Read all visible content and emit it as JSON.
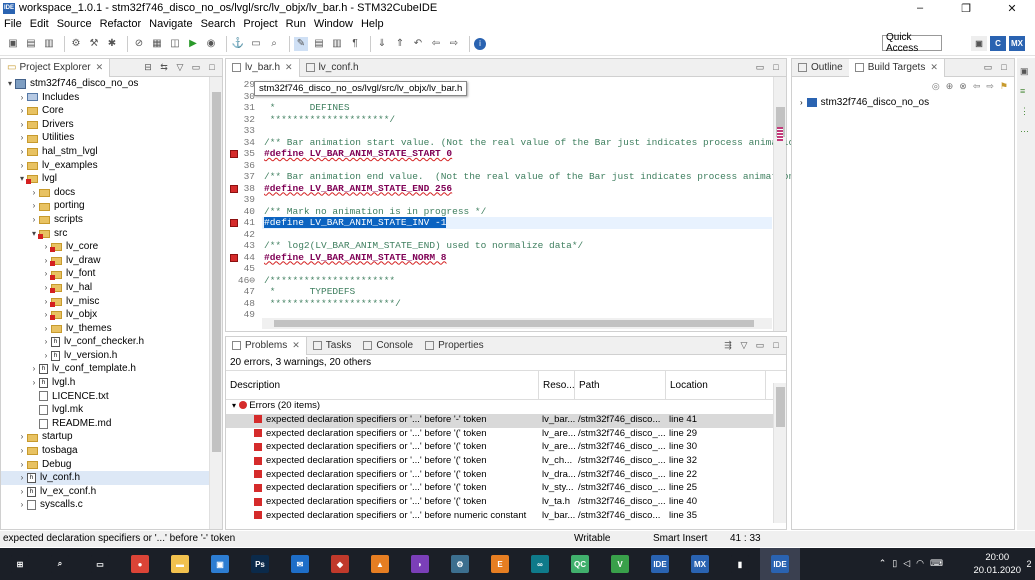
{
  "window": {
    "title": "workspace_1.0.1 - stm32f746_disco_no_os/lvgl/src/lv_objx/lv_bar.h - STM32CubeIDE",
    "app_icon": "IDE",
    "minimize": "–",
    "maximize": "❐",
    "close": "✕"
  },
  "menu": [
    "File",
    "Edit",
    "Source",
    "Refactor",
    "Navigate",
    "Search",
    "Project",
    "Run",
    "Window",
    "Help"
  ],
  "quick_access": "Quick Access",
  "project_explorer": {
    "tab_label": "Project Explorer",
    "items": [
      {
        "label": "stm32f746_disco_no_os",
        "depth": 0,
        "tw": "▾",
        "icon": "proj"
      },
      {
        "label": "Includes",
        "depth": 1,
        "tw": "›",
        "icon": "lib"
      },
      {
        "label": "Core",
        "depth": 1,
        "tw": "›",
        "icon": "folder"
      },
      {
        "label": "Drivers",
        "depth": 1,
        "tw": "›",
        "icon": "folder"
      },
      {
        "label": "Utilities",
        "depth": 1,
        "tw": "›",
        "icon": "folder"
      },
      {
        "label": "hal_stm_lvgl",
        "depth": 1,
        "tw": "›",
        "icon": "folder"
      },
      {
        "label": "lv_examples",
        "depth": 1,
        "tw": "›",
        "icon": "folder"
      },
      {
        "label": "lvgl",
        "depth": 1,
        "tw": "▾",
        "icon": "folder",
        "err": true
      },
      {
        "label": "docs",
        "depth": 2,
        "tw": "›",
        "icon": "folder"
      },
      {
        "label": "porting",
        "depth": 2,
        "tw": "›",
        "icon": "folder"
      },
      {
        "label": "scripts",
        "depth": 2,
        "tw": "›",
        "icon": "folder"
      },
      {
        "label": "src",
        "depth": 2,
        "tw": "▾",
        "icon": "folder",
        "err": true
      },
      {
        "label": "lv_core",
        "depth": 3,
        "tw": "›",
        "icon": "folder",
        "err": true
      },
      {
        "label": "lv_draw",
        "depth": 3,
        "tw": "›",
        "icon": "folder",
        "err": true
      },
      {
        "label": "lv_font",
        "depth": 3,
        "tw": "›",
        "icon": "folder",
        "err": true
      },
      {
        "label": "lv_hal",
        "depth": 3,
        "tw": "›",
        "icon": "folder",
        "err": true
      },
      {
        "label": "lv_misc",
        "depth": 3,
        "tw": "›",
        "icon": "folder",
        "err": true
      },
      {
        "label": "lv_objx",
        "depth": 3,
        "tw": "›",
        "icon": "folder",
        "err": true
      },
      {
        "label": "lv_themes",
        "depth": 3,
        "tw": "›",
        "icon": "folder"
      },
      {
        "label": "lv_conf_checker.h",
        "depth": 3,
        "tw": "›",
        "icon": "hfile"
      },
      {
        "label": "lv_version.h",
        "depth": 3,
        "tw": "›",
        "icon": "hfile"
      },
      {
        "label": "lv_conf_template.h",
        "depth": 2,
        "tw": "›",
        "icon": "hfile"
      },
      {
        "label": "lvgl.h",
        "depth": 2,
        "tw": "›",
        "icon": "hfile"
      },
      {
        "label": "LICENCE.txt",
        "depth": 2,
        "tw": "",
        "icon": "file"
      },
      {
        "label": "lvgl.mk",
        "depth": 2,
        "tw": "",
        "icon": "file"
      },
      {
        "label": "README.md",
        "depth": 2,
        "tw": "",
        "icon": "file"
      },
      {
        "label": "startup",
        "depth": 1,
        "tw": "›",
        "icon": "folder"
      },
      {
        "label": "tosbaga",
        "depth": 1,
        "tw": "›",
        "icon": "folder"
      },
      {
        "label": "Debug",
        "depth": 1,
        "tw": "›",
        "icon": "folder"
      },
      {
        "label": "lv_conf.h",
        "depth": 1,
        "tw": "›",
        "icon": "hfile",
        "selected": true
      },
      {
        "label": "lv_ex_conf.h",
        "depth": 1,
        "tw": "›",
        "icon": "hfile"
      },
      {
        "label": "syscalls.c",
        "depth": 1,
        "tw": "›",
        "icon": "file"
      }
    ]
  },
  "editor": {
    "tabs": [
      {
        "label": "lv_bar.h",
        "active": true
      },
      {
        "label": "lv_conf.h",
        "active": false
      }
    ],
    "tooltip": "stm32f746_disco_no_os/lvgl/src/lv_objx/lv_bar.h",
    "lines": [
      {
        "n": "29",
        "text": "",
        "cls": "cm"
      },
      {
        "n": "30",
        "text": "",
        "cls": "cm"
      },
      {
        "n": "31",
        "text": " *      DEFINES",
        "cls": "cm"
      },
      {
        "n": "32",
        "text": " *********************/",
        "cls": "cm"
      },
      {
        "n": "33",
        "text": "",
        "cls": "def"
      },
      {
        "n": "34",
        "text": "/** Bar animation start value. (Not the real value of the Bar just indicates process animation)",
        "cls": "cm"
      },
      {
        "n": "35",
        "text": "#define LV_BAR_ANIM_STATE_START 0",
        "cls": "kw",
        "err": true
      },
      {
        "n": "36",
        "text": "",
        "cls": "def"
      },
      {
        "n": "37",
        "text": "/** Bar animation end value.  (Not the real value of the Bar just indicates process animation)*",
        "cls": "cm"
      },
      {
        "n": "38",
        "text": "#define LV_BAR_ANIM_STATE_END 256",
        "cls": "kw",
        "err": true
      },
      {
        "n": "39",
        "text": "",
        "cls": "def"
      },
      {
        "n": "40",
        "text": "/** Mark no animation is in progress */",
        "cls": "cm"
      },
      {
        "n": "41",
        "text": "#define LV_BAR_ANIM_STATE_INV -1",
        "cls": "sel",
        "err": true,
        "current": true
      },
      {
        "n": "42",
        "text": "",
        "cls": "def"
      },
      {
        "n": "43",
        "text": "/** log2(LV_BAR_ANIM_STATE_END) used to normalize data*/",
        "cls": "cm"
      },
      {
        "n": "44",
        "text": "#define LV_BAR_ANIM_STATE_NORM 8",
        "cls": "kw",
        "err": true
      },
      {
        "n": "45",
        "text": "",
        "cls": "def"
      },
      {
        "n": "46⊖",
        "text": "/**********************",
        "cls": "cm"
      },
      {
        "n": "47",
        "text": " *      TYPEDEFS",
        "cls": "cm"
      },
      {
        "n": "48",
        "text": " **********************/",
        "cls": "cm"
      },
      {
        "n": "49",
        "text": "",
        "cls": "def"
      }
    ]
  },
  "outline": {
    "tabs": [
      {
        "label": "Outline",
        "active": false
      },
      {
        "label": "Build Targets",
        "active": true
      }
    ],
    "items": [
      {
        "label": "stm32f746_disco_no_os"
      }
    ]
  },
  "problems": {
    "tabs": [
      {
        "label": "Problems",
        "active": true
      },
      {
        "label": "Tasks",
        "active": false
      },
      {
        "label": "Console",
        "active": false
      },
      {
        "label": "Properties",
        "active": false
      }
    ],
    "summary": "20 errors, 3 warnings, 20 others",
    "columns": [
      "Description",
      "Reso...",
      "Path",
      "Location"
    ],
    "group": "Errors (20 items)",
    "rows": [
      {
        "desc": "expected declaration specifiers or '...' before '-' token",
        "res": "lv_bar...",
        "path": "/stm32f746_disco...",
        "loc": "line 41",
        "selected": true
      },
      {
        "desc": "expected declaration specifiers or '...' before '(' token",
        "res": "lv_are...",
        "path": "/stm32f746_disco_...",
        "loc": "line 29"
      },
      {
        "desc": "expected declaration specifiers or '...' before '(' token",
        "res": "lv_are...",
        "path": "/stm32f746_disco_...",
        "loc": "line 30"
      },
      {
        "desc": "expected declaration specifiers or '...' before '(' token",
        "res": "lv_ch...",
        "path": "/stm32f746_disco_...",
        "loc": "line 32"
      },
      {
        "desc": "expected declaration specifiers or '...' before '(' token",
        "res": "lv_dra...",
        "path": "/stm32f746_disco_...",
        "loc": "line 22"
      },
      {
        "desc": "expected declaration specifiers or '...' before '(' token",
        "res": "lv_sty...",
        "path": "/stm32f746_disco_...",
        "loc": "line 25"
      },
      {
        "desc": "expected declaration specifiers or '...' before '(' token",
        "res": "lv_ta.h",
        "path": "/stm32f746_disco_...",
        "loc": "line 40"
      },
      {
        "desc": "expected declaration specifiers or '...' before numeric constant",
        "res": "lv_bar...",
        "path": "/stm32f746_disco...",
        "loc": "line 35"
      }
    ]
  },
  "status": {
    "message": "expected declaration specifiers or '...' before '-' token",
    "writable": "Writable",
    "insert": "Smart Insert",
    "position": "41 : 33"
  },
  "taskbar": {
    "apps": [
      {
        "name": "start",
        "label": "⊞",
        "color": "#1b1f27"
      },
      {
        "name": "search",
        "label": "⌕",
        "color": "#1b1f27"
      },
      {
        "name": "taskview",
        "label": "▭",
        "color": "#1b1f27"
      },
      {
        "name": "chrome",
        "label": "●",
        "color": "#db4437"
      },
      {
        "name": "explorer",
        "label": "▬",
        "color": "#f2c14e"
      },
      {
        "name": "store",
        "label": "▣",
        "color": "#2d7dd2"
      },
      {
        "name": "photoshop",
        "label": "Ps",
        "color": "#0b2a4a"
      },
      {
        "name": "mail",
        "label": "✉",
        "color": "#1e6ec8"
      },
      {
        "name": "app-red",
        "label": "◆",
        "color": "#c0392b"
      },
      {
        "name": "matlab",
        "label": "▲",
        "color": "#e67e22"
      },
      {
        "name": "visual-studio",
        "label": "◗",
        "color": "#7b3fb8"
      },
      {
        "name": "app-gear",
        "label": "⚙",
        "color": "#3c6f8f"
      },
      {
        "name": "app-e",
        "label": "E",
        "color": "#e67e22"
      },
      {
        "name": "arduino",
        "label": "∞",
        "color": "#0f7a8a"
      },
      {
        "name": "qt",
        "label": "QC",
        "color": "#41b06d"
      },
      {
        "name": "cubemx-green",
        "label": "V",
        "color": "#39a04a"
      },
      {
        "name": "ide-blue",
        "label": "IDE",
        "color": "#2a63b1"
      },
      {
        "name": "mx",
        "label": "MX",
        "color": "#2a63b1"
      },
      {
        "name": "stats",
        "label": "▮",
        "color": "#1b1f27"
      },
      {
        "name": "ide-active",
        "label": "IDE",
        "color": "#2a63b1"
      }
    ],
    "time": "20:00",
    "date": "20.01.2020",
    "notifications": "2"
  }
}
